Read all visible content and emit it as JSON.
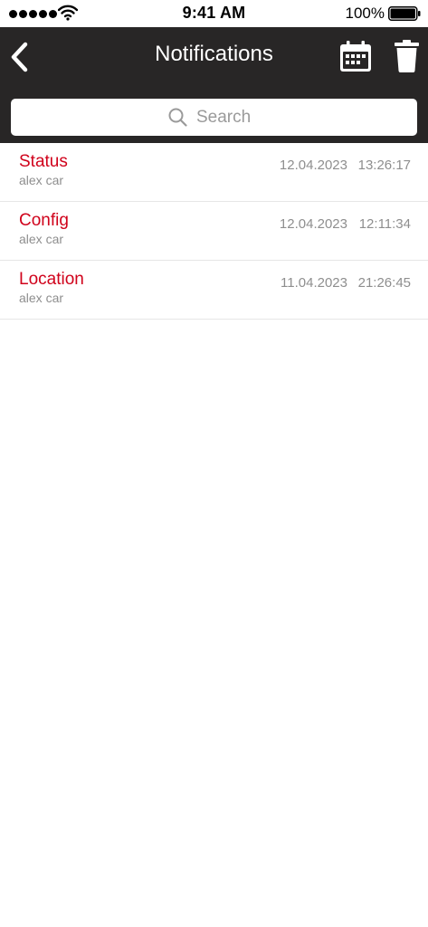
{
  "status_bar": {
    "time": "9:41 AM",
    "battery": "100%",
    "icons": [
      "signal-dots-icon",
      "wifi-icon",
      "battery-icon"
    ]
  },
  "nav": {
    "title": "Notifications",
    "back_icon": "chevron-left-icon",
    "calendar_icon": "calendar-icon",
    "trash_icon": "trash-icon"
  },
  "search": {
    "placeholder": "Search",
    "value": ""
  },
  "notifications": [
    {
      "title": "Status",
      "subtitle": "alex car",
      "date": "12.04.2023",
      "time": "13:26:17"
    },
    {
      "title": "Config",
      "subtitle": "alex car",
      "date": "12.04.2023",
      "time": "12:11:34"
    },
    {
      "title": "Location",
      "subtitle": "alex car",
      "date": "11.04.2023",
      "time": "21:26:45"
    }
  ],
  "colors": {
    "nav_background": "#282626",
    "accent_red": "#d0021b",
    "secondary_text": "#8e8e8e"
  }
}
